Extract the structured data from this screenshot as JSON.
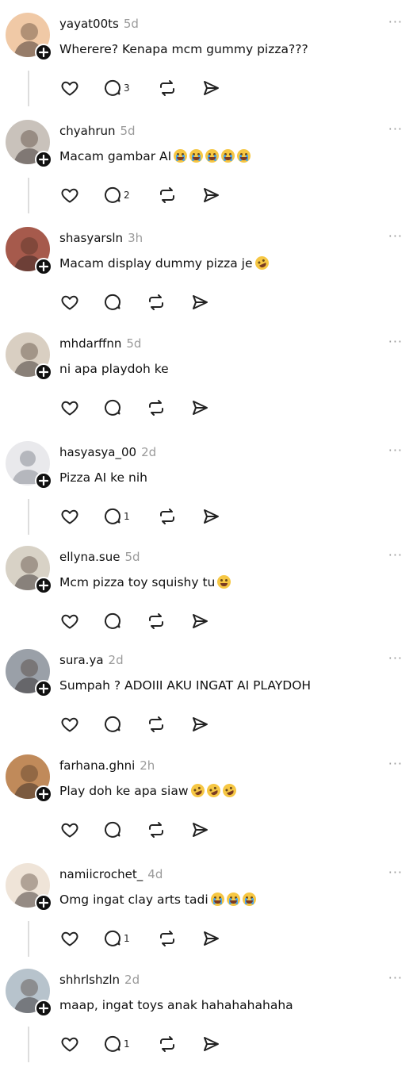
{
  "ui": {
    "more_label": "···",
    "accent": "#111111",
    "muted": "#9a9a9a",
    "line": "#dddddd"
  },
  "posts": [
    {
      "username": "yayat00ts",
      "time": "5d",
      "text": "Wherere? Kenapa mcm gummy pizza???",
      "emojis": [],
      "replies": "3",
      "thread": true,
      "avatar": "#f0c9a6"
    },
    {
      "username": "chyahrun",
      "time": "5d",
      "text": "Macam gambar AI",
      "emojis": [
        "cry",
        "cry",
        "cry",
        "cry",
        "cry"
      ],
      "replies": "2",
      "thread": true,
      "avatar": "#c9c2bb"
    },
    {
      "username": "shasyarsln",
      "time": "3h",
      "text": "Macam display dummy pizza je",
      "emojis": [
        "laugh"
      ],
      "replies": "",
      "thread": false,
      "avatar": "#a65a4c"
    },
    {
      "username": "mhdarffnn",
      "time": "5d",
      "text": "ni apa playdoh ke",
      "emojis": [],
      "replies": "",
      "thread": false,
      "avatar": "#d9cfc2"
    },
    {
      "username": "hasyasya_00",
      "time": "2d",
      "text": "Pizza AI ke nih",
      "emojis": [],
      "replies": "1",
      "thread": true,
      "avatar": "#e6e6ea"
    },
    {
      "username": "ellyna.sue",
      "time": "5d",
      "text": "Mcm pizza toy squishy tu",
      "emojis": [
        "grin"
      ],
      "replies": "",
      "thread": false,
      "avatar": "#d8d2c6"
    },
    {
      "username": "sura.ya",
      "time": "2d",
      "text": "Sumpah ? ADOIII AKU INGAT AI PLAYDOH",
      "emojis": [],
      "replies": "",
      "thread": false,
      "avatar": "#9aa0a8"
    },
    {
      "username": "farhana.ghni",
      "time": "2h",
      "text": "Play doh ke apa siaw",
      "emojis": [
        "laugh",
        "laugh",
        "laugh"
      ],
      "replies": "",
      "thread": false,
      "avatar": "#c08a5a"
    },
    {
      "username": "namiicrochet_",
      "time": "4d",
      "text": "Omg ingat clay arts tadi",
      "emojis": [
        "cry",
        "cry",
        "cry"
      ],
      "replies": "1",
      "thread": true,
      "avatar": "#efe4d8"
    },
    {
      "username": "shhrlshzln",
      "time": "2d",
      "text": "maap, ingat toys anak hahahahahaha",
      "emojis": [],
      "replies": "1",
      "thread": true,
      "avatar": "#b7c3cc"
    }
  ]
}
